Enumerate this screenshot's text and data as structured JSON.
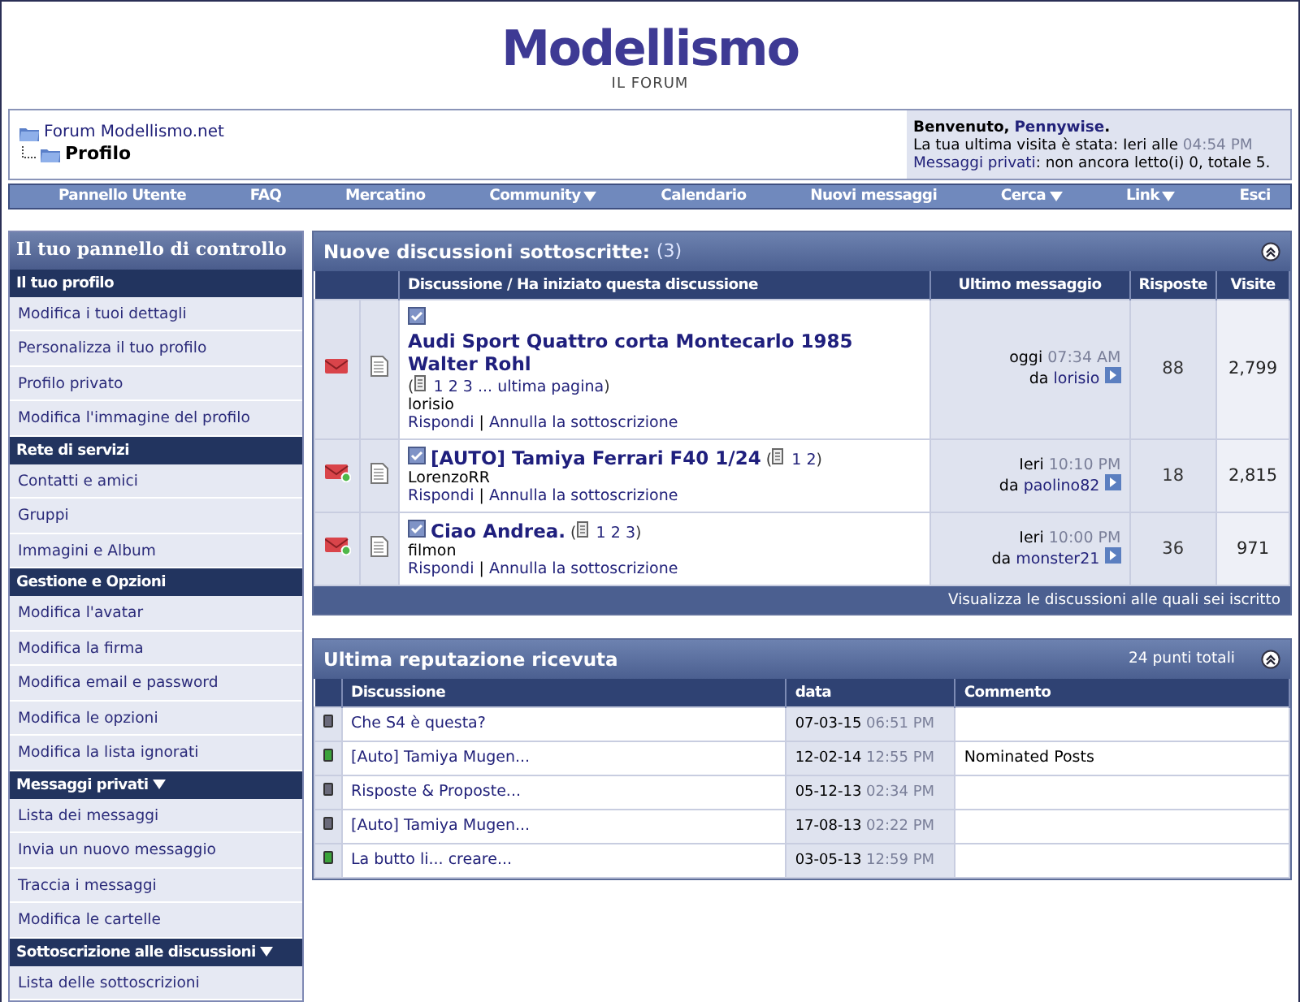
{
  "logo": {
    "name": "Modellismo",
    "subtitle": "IL FORUM"
  },
  "breadcrumb": {
    "parent": "Forum Modellismo.net",
    "current": "Profilo"
  },
  "welcome": {
    "greeting": "Benvenuto,",
    "user": "Pennywise",
    "end": ".",
    "last_visit": "La tua ultima visita è stata: Ieri alle",
    "last_visit_time": "04:54 PM",
    "pm_link": "Messaggi privati",
    "pm_text": ": non ancora letto(i) 0, totale 5."
  },
  "nav": [
    {
      "label": "Pannello Utente",
      "dropdown": false
    },
    {
      "label": "FAQ",
      "dropdown": false
    },
    {
      "label": "Mercatino",
      "dropdown": false
    },
    {
      "label": "Community",
      "dropdown": true
    },
    {
      "label": "Calendario",
      "dropdown": false
    },
    {
      "label": "Nuovi messaggi",
      "dropdown": false
    },
    {
      "label": "Cerca",
      "dropdown": true
    },
    {
      "label": "Link",
      "dropdown": true
    },
    {
      "label": "Esci",
      "dropdown": false
    }
  ],
  "sidebar": {
    "title": "Il tuo pannello di controllo",
    "sections": [
      {
        "title": "Il tuo profilo",
        "dropdown": false,
        "items": [
          "Modifica i tuoi dettagli",
          "Personalizza il tuo profilo",
          "Profilo privato",
          "Modifica l'immagine del profilo"
        ]
      },
      {
        "title": "Rete di servizi",
        "dropdown": false,
        "items": [
          "Contatti e amici",
          "Gruppi",
          "Immagini e Album"
        ]
      },
      {
        "title": "Gestione e Opzioni",
        "dropdown": false,
        "items": [
          "Modifica l'avatar",
          "Modifica la firma",
          "Modifica email e password",
          "Modifica le opzioni",
          "Modifica la lista ignorati"
        ]
      },
      {
        "title": "Messaggi privati",
        "dropdown": true,
        "items": [
          "Lista dei messaggi",
          "Invia un nuovo messaggio",
          "Traccia i messaggi",
          "Modifica le cartelle"
        ]
      },
      {
        "title": "Sottoscrizione alle discussioni",
        "dropdown": true,
        "items": [
          "Lista delle sottoscrizioni"
        ]
      }
    ]
  },
  "subscriptions": {
    "title": "Nuove discussioni sottoscritte:",
    "count": "(3)",
    "columns": [
      "Discussione / Ha iniziato questa discussione",
      "Ultimo messaggio",
      "Risposte",
      "Visite"
    ],
    "threads": [
      {
        "title": "Audi Sport Quattro corta Montecarlo 1985 Walter Rohl",
        "new_badge": false,
        "pages": {
          "open": "(",
          "links": [
            "1",
            "2",
            "3",
            "... ultima pagina"
          ],
          "close": ")"
        },
        "starter": "lorisio",
        "actions": [
          "Rispondi",
          "Annulla la sottoscrizione"
        ],
        "separator": "|",
        "last": {
          "day": "oggi",
          "time": "07:34 AM",
          "by": "da",
          "user": "lorisio"
        },
        "replies": "88",
        "views": "2,799"
      },
      {
        "title": "[AUTO] Tamiya Ferrari F40 1/24",
        "new_badge": true,
        "pages": {
          "open": "(",
          "links": [
            "1",
            "2"
          ],
          "close": ")"
        },
        "starter": "LorenzoRR",
        "actions": [
          "Rispondi",
          "Annulla la sottoscrizione"
        ],
        "separator": "|",
        "last": {
          "day": "Ieri",
          "time": "10:10 PM",
          "by": "da",
          "user": "paolino82"
        },
        "replies": "18",
        "views": "2,815"
      },
      {
        "title": "Ciao Andrea.",
        "new_badge": true,
        "pages": {
          "open": "(",
          "links": [
            "1",
            "2",
            "3"
          ],
          "close": ")"
        },
        "starter": "filmon",
        "actions": [
          "Rispondi",
          "Annulla la sottoscrizione"
        ],
        "separator": "|",
        "last": {
          "day": "Ieri",
          "time": "10:00 PM",
          "by": "da",
          "user": "monster21"
        },
        "replies": "36",
        "views": "971"
      }
    ],
    "footer_link": "Visualizza le discussioni alle quali sei iscritto"
  },
  "reputation": {
    "title": "Ultima reputazione ricevuta",
    "total": "24 punti totali",
    "columns": [
      "Discussione",
      "data",
      "Commento"
    ],
    "rows": [
      {
        "color": "#6a6a7a",
        "thread": "Che S4 è questa?",
        "date": "07-03-15",
        "time": "06:51 PM"
      },
      {
        "color": "#3aa33a",
        "thread": "[Auto] Tamiya Mugen...",
        "date": "12-02-14",
        "time": "12:55 PM",
        "comment": "Nominated Posts"
      },
      {
        "color": "#6a6a7a",
        "thread": "Risposte & Proposte...",
        "date": "05-12-13",
        "time": "02:34 PM"
      },
      {
        "color": "#6a6a7a",
        "thread": "[Auto] Tamiya Mugen...",
        "date": "17-08-13",
        "time": "02:22 PM"
      },
      {
        "color": "#3aa33a",
        "thread": "La butto li... creare...",
        "date": "03-05-13",
        "time": "12:59 PM"
      }
    ]
  }
}
